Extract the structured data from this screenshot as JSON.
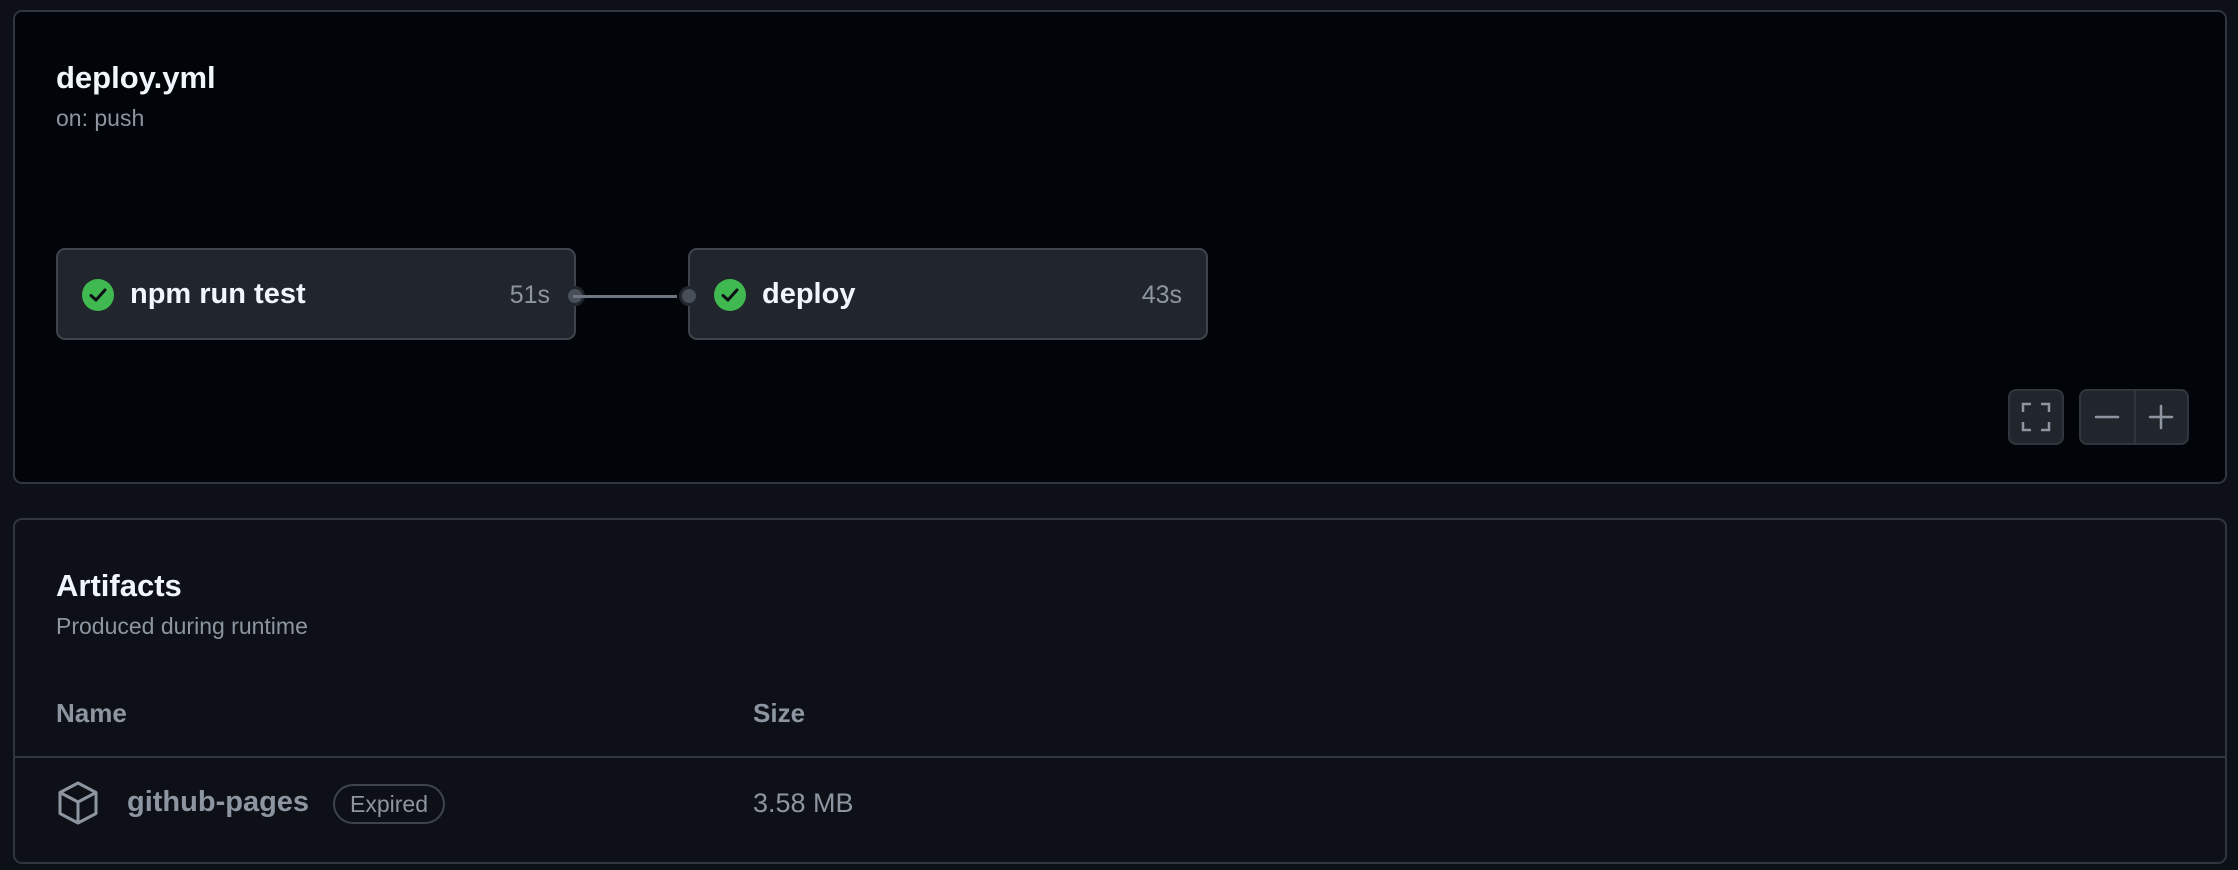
{
  "workflow": {
    "title": "deploy.yml",
    "trigger": "on: push",
    "jobs": [
      {
        "name": "npm run test",
        "duration": "51s",
        "status": "success"
      },
      {
        "name": "deploy",
        "duration": "43s",
        "status": "success"
      }
    ],
    "controls": {
      "fullscreen_icon": "fullscreen-icon",
      "zoom_out_icon": "minus-icon",
      "zoom_in_icon": "plus-icon"
    }
  },
  "artifacts": {
    "title": "Artifacts",
    "subtitle": "Produced during runtime",
    "columns": [
      "Name",
      "Size"
    ],
    "rows": [
      {
        "icon": "package-icon",
        "name": "github-pages",
        "badge": "Expired",
        "size": "3.58 MB"
      }
    ]
  },
  "colors": {
    "success": "#3fb950",
    "panel_bg": "#010409",
    "page_bg": "#0d1117",
    "border": "#30363d"
  }
}
